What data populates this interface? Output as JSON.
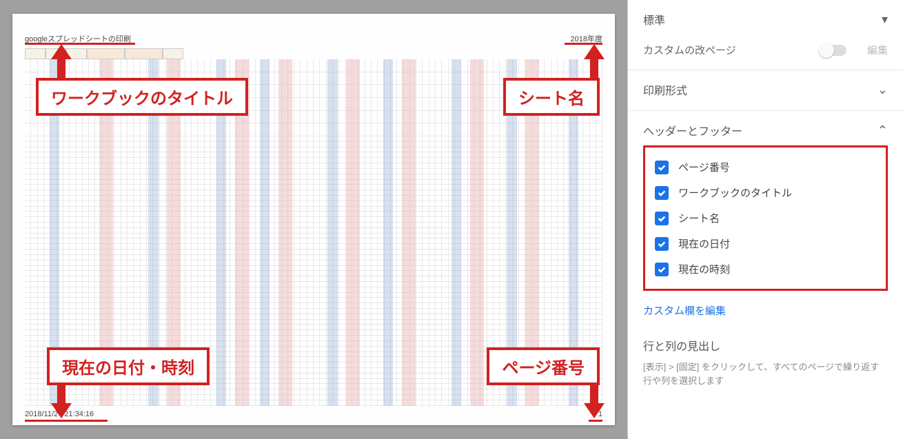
{
  "preview": {
    "header_left": "googleスプレッドシートの印刷",
    "header_right": "2018年度",
    "footer_left": "2018/11/24 21:34:16",
    "footer_right": "1"
  },
  "callouts": {
    "workbook_title": "ワークブックのタイトル",
    "sheet_name": "シート名",
    "date_time": "現在の日付・時刻",
    "page_number": "ページ番号"
  },
  "sidebar": {
    "standard": {
      "label": "標準"
    },
    "custom_breaks": {
      "label": "カスタムの改ページ",
      "edit": "編集"
    },
    "print_format": {
      "label": "印刷形式"
    },
    "header_footer": {
      "label": "ヘッダーとフッター",
      "items": [
        {
          "label": "ページ番号",
          "checked": true
        },
        {
          "label": "ワークブックのタイトル",
          "checked": true
        },
        {
          "label": "シート名",
          "checked": true
        },
        {
          "label": "現在の日付",
          "checked": true
        },
        {
          "label": "現在の時刻",
          "checked": true
        }
      ],
      "custom_link": "カスタム欄を編集"
    },
    "row_col_headings": {
      "label": "行と列の見出し",
      "desc": "[表示] > [固定] をクリックして、すべてのページで繰り返す行や列を選択します"
    }
  }
}
